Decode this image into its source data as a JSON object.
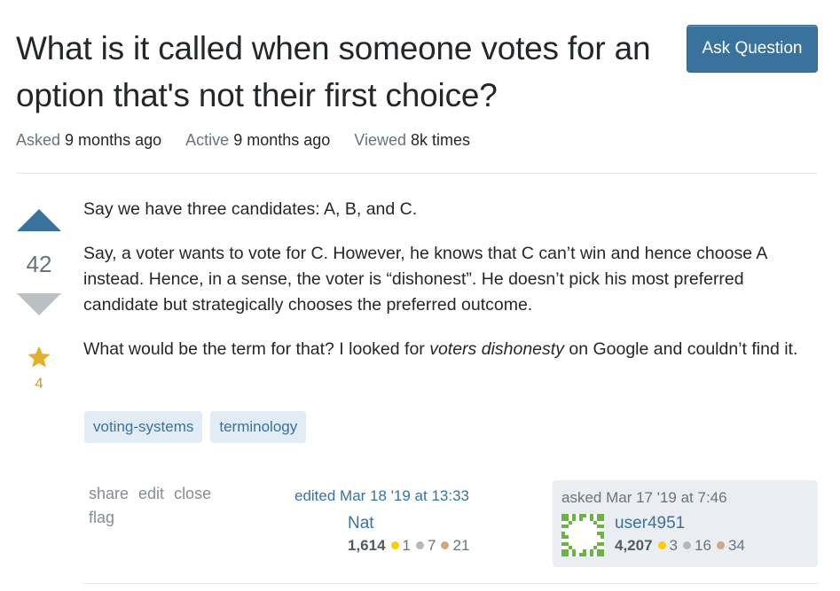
{
  "question": {
    "title": "What is it called when someone votes for an option that's not their first choice?",
    "meta": [
      {
        "label": "Asked",
        "value": "9 months ago"
      },
      {
        "label": "Active",
        "value": "9 months ago"
      },
      {
        "label": "Viewed",
        "value": "8k times"
      }
    ],
    "votes": "42",
    "vote_state": "upvoted",
    "favorites": "4",
    "body": {
      "p1": "Say we have three candidates: A, B, and C.",
      "p2": "Say, a voter wants to vote for C. However, he knows that C can’t win and hence choose A instead. Hence, in a sense, the voter is “dishonest”. He doesn’t pick his most preferred candidate but strategically chooses the preferred outcome.",
      "p3_before": "What would be the term for that? I looked for ",
      "p3_emphasis": "voters dishonesty",
      "p3_after": " on Google and couldn’t find it."
    },
    "tags": [
      "voting-systems",
      "terminology"
    ]
  },
  "header": {
    "ask_button_label": "Ask Question"
  },
  "post_menu": {
    "share": "share",
    "edit": "edit",
    "close": "close",
    "flag": "flag"
  },
  "editor": {
    "action": "edited Mar 18 '19 at 13:33",
    "name": "Nat",
    "reputation": "1,614",
    "gold": "1",
    "silver": "7",
    "bronze": "21"
  },
  "owner": {
    "action": "asked Mar 17 '19 at 7:46",
    "name": "user4951",
    "reputation": "4,207",
    "gold": "3",
    "silver": "16",
    "bronze": "34",
    "avatar_icon": "identicon-avatar"
  },
  "colors": {
    "accent": "#39739d",
    "tag_bg": "#e1ecf4",
    "star": "#e3b02b",
    "owner_card_bg": "#eaeef2",
    "avatar_green": "#6ab344"
  }
}
